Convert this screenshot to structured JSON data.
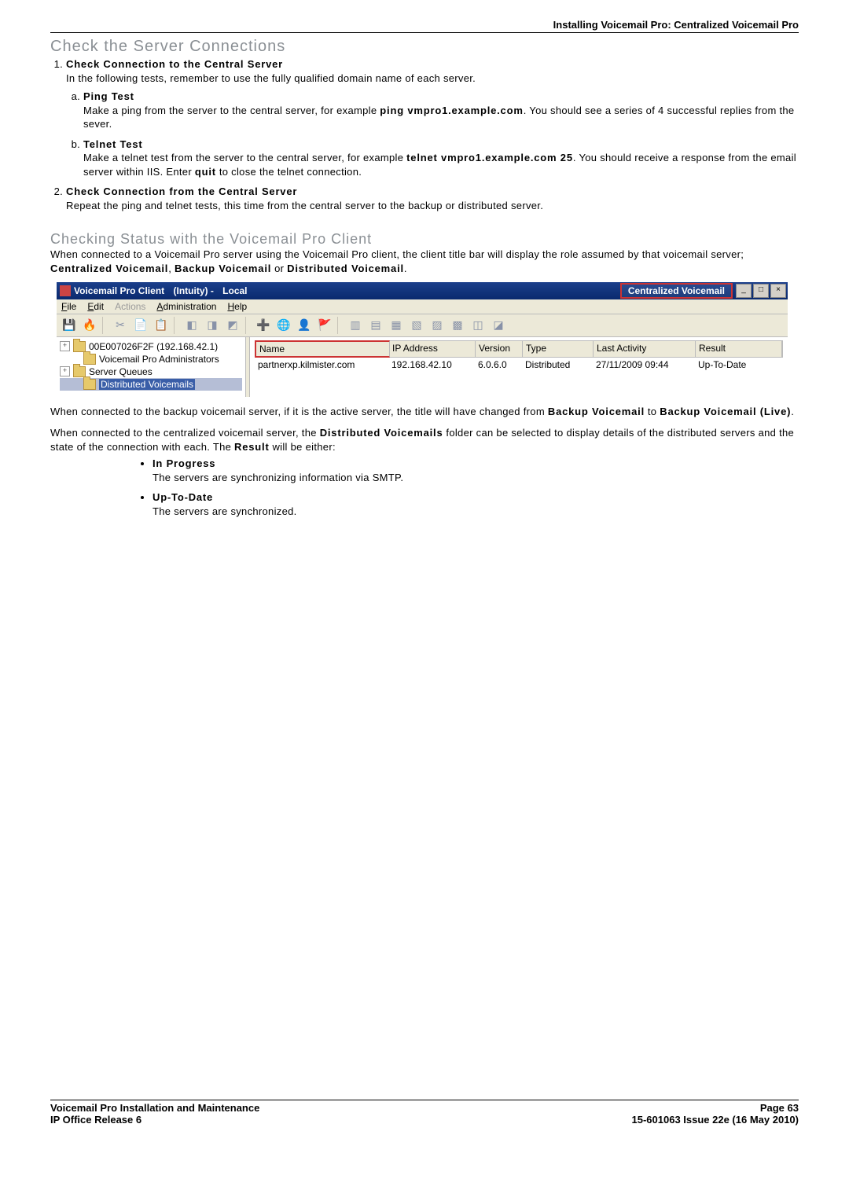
{
  "header": {
    "breadcrumb": "Installing Voicemail Pro: Centralized Voicemail Pro"
  },
  "s1": {
    "title": "Check the Server Connections",
    "items": [
      {
        "h": "Check Connection to the Central Server",
        "intro": "In the following tests, remember to use the fully qualified domain name of each server.",
        "sub": [
          {
            "h": "Ping Test",
            "t1": "Make a ping from the server to the central server, for example ",
            "c": "ping vmpro1.example.com",
            "t2": ". You should see a series of 4 successful replies from the sever."
          },
          {
            "h": "Telnet Test",
            "t1": "Make a telnet test from the server to the central server, for example ",
            "c": "telnet vmpro1.example.com 25",
            "t2": ". You should receive a response from the email server within IIS. Enter ",
            "c2": "quit",
            "t3": " to close the telnet connection."
          }
        ]
      },
      {
        "h": "Check Connection from the Central Server",
        "intro": "Repeat the ping and telnet tests, this time from the central server to the backup or distributed server."
      }
    ]
  },
  "s2": {
    "title": "Checking Status with the Voicemail Pro Client",
    "p1a": "When connected to a Voicemail Pro server using the Voicemail Pro client, the client title bar will display the role assumed by that voicemail server; ",
    "p1b": "Centralized Voicemail",
    "p1c": ", ",
    "p1d": "Backup Voicemail",
    "p1e": " or ",
    "p1f": "Distributed Voicemail",
    "p1g": ".",
    "p2a": "When connected to the backup voicemail server, if it is the active server, the title will have changed from ",
    "p2b": "Backup Voicemail",
    "p2c": " to ",
    "p2d": "Backup Voicemail (Live)",
    "p2e": ".",
    "p3a": "When connected to the centralized voicemail server, the ",
    "p3b": "Distributed Voicemails",
    "p3c": " folder can be selected to display details of the distributed servers and the state of the connection with each. The ",
    "p3d": "Result",
    "p3e": " will be either:",
    "bullets": [
      {
        "h": "In Progress",
        "t": "The servers are synchronizing information via SMTP."
      },
      {
        "h": "Up-To-Date",
        "t": "The servers are synchronized."
      }
    ]
  },
  "app": {
    "title_a": "Voicemail Pro Client",
    "title_b": "(Intuity) -",
    "title_c": "Local",
    "title_box": "Centralized Voicemail",
    "winbtns": {
      "min": "_",
      "max": "□",
      "close": "×"
    },
    "menu": {
      "file": "File",
      "edit": "Edit",
      "actions": "Actions",
      "admin": "Administration",
      "help": "Help"
    },
    "tree": {
      "n0": "00E007026F2F (192.168.42.1)",
      "n1": "Voicemail Pro Administrators",
      "n2": "Server Queues",
      "n3": "Distributed Voicemails"
    },
    "cols": {
      "name": "Name",
      "ip": "IP Address",
      "ver": "Version",
      "type": "Type",
      "last": "Last Activity",
      "res": "Result"
    },
    "row": {
      "name": "partnerxp.kilmister.com",
      "ip": "192.168.42.10",
      "ver": "6.0.6.0",
      "type": "Distributed",
      "last": "27/11/2009 09:44",
      "res": "Up-To-Date"
    }
  },
  "footer": {
    "l1": "Voicemail Pro Installation and Maintenance",
    "r1": "Page 63",
    "l2": "IP Office Release 6",
    "r2": "15-601063 Issue 22e (16 May 2010)"
  }
}
